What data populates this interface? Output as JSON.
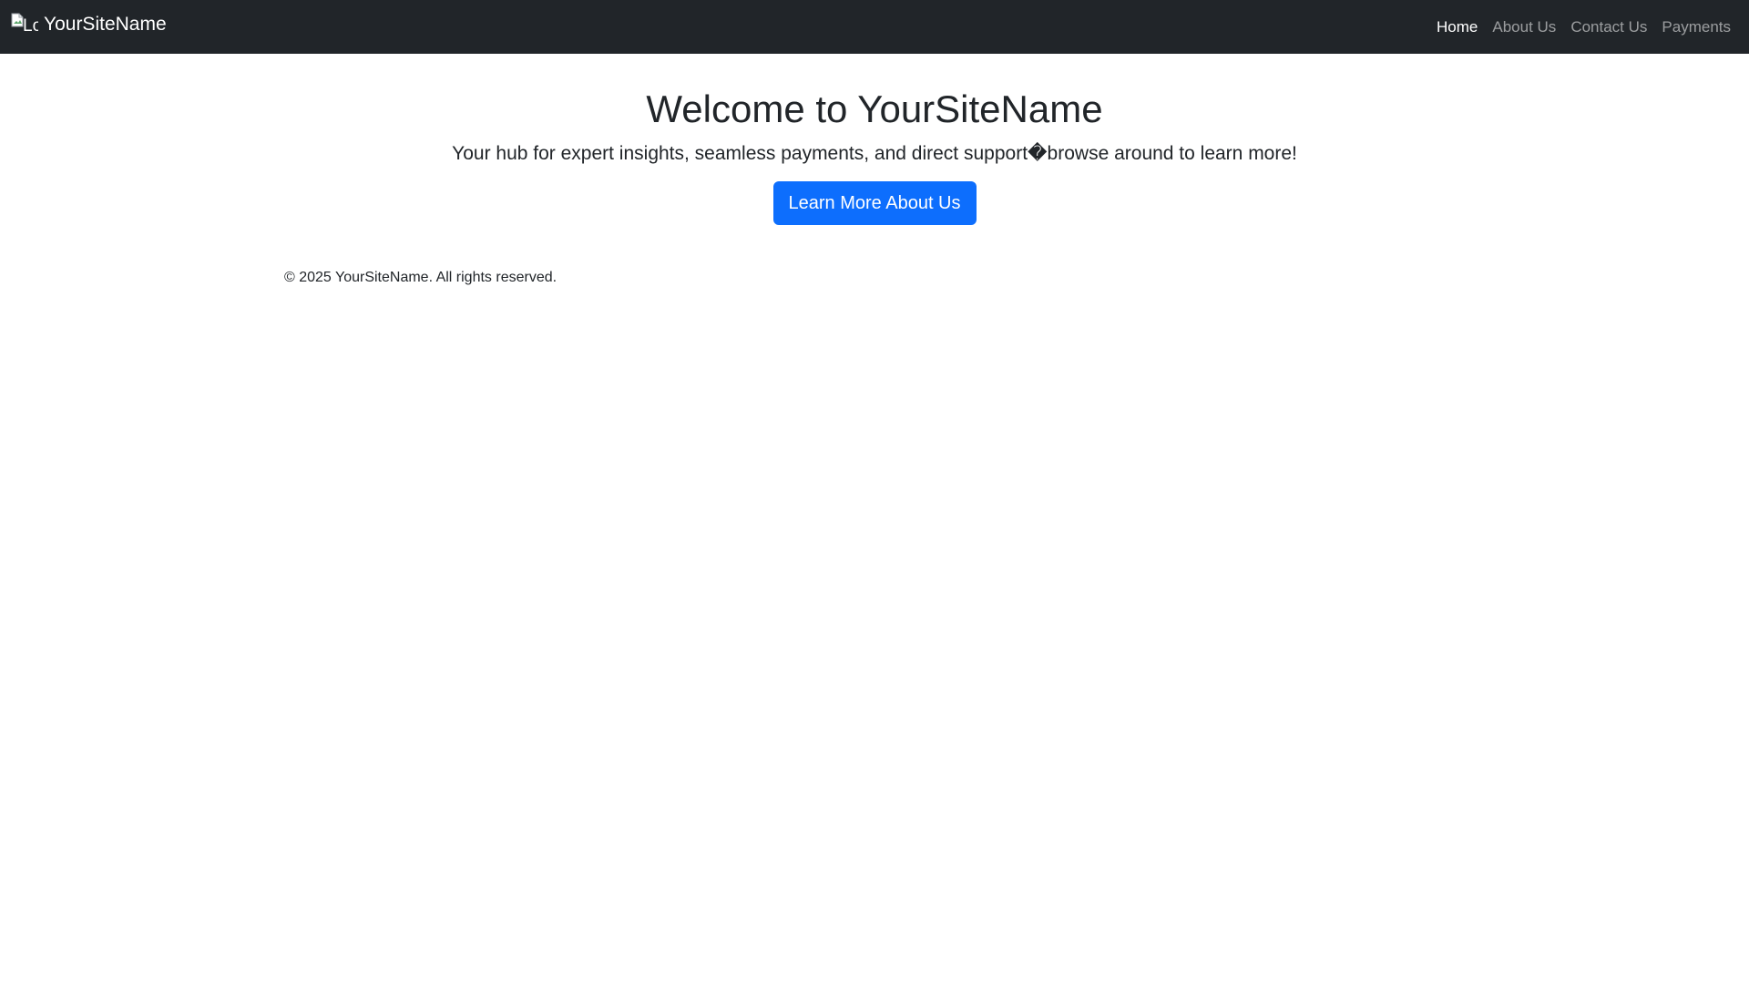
{
  "navbar": {
    "logo_alt": "Logo",
    "brand_name": "YourSiteName",
    "links": [
      {
        "label": "Home",
        "active": true
      },
      {
        "label": "About Us",
        "active": false
      },
      {
        "label": "Contact Us",
        "active": false
      },
      {
        "label": "Payments",
        "active": false
      }
    ]
  },
  "hero": {
    "title": "Welcome to YourSiteName",
    "subtitle": "Your hub for expert insights, seamless payments, and direct support�browse around to learn more!",
    "cta_label": "Learn More About Us"
  },
  "footer": {
    "copyright": "© 2025 YourSiteName. All rights reserved."
  },
  "colors": {
    "navbar_bg": "#212529",
    "primary": "#0d6efd",
    "text": "#212529"
  },
  "icons": {
    "logo": "broken-image-icon"
  }
}
